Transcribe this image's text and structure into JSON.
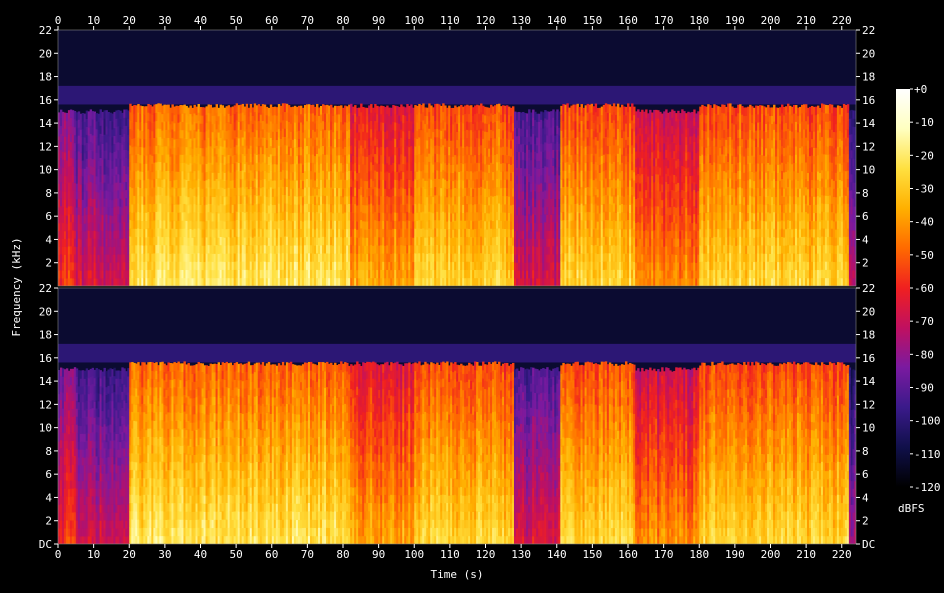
{
  "chart_data": {
    "type": "heatmap",
    "xlabel": "Time (s)",
    "ylabel": "Frequency (kHz)",
    "colorbar_label": "dBFS",
    "x_ticks": [
      0,
      10,
      20,
      30,
      40,
      50,
      60,
      70,
      80,
      90,
      100,
      110,
      120,
      130,
      140,
      150,
      160,
      170,
      180,
      190,
      200,
      210,
      220
    ],
    "xlim": [
      0,
      224
    ],
    "y_ticks": [
      "DC",
      "2",
      "4",
      "6",
      "8",
      "10",
      "12",
      "14",
      "16",
      "18",
      "20",
      "22"
    ],
    "y_tick_values": [
      0,
      2,
      4,
      6,
      8,
      10,
      12,
      14,
      16,
      18,
      20,
      22
    ],
    "ylim": [
      0,
      22
    ],
    "colorbar_ticks": [
      "+0",
      "-10",
      "-20",
      "-30",
      "-40",
      "-50",
      "-60",
      "-70",
      "-80",
      "-90",
      "-100",
      "-110",
      "-120"
    ],
    "colorbar_values": [
      0,
      -10,
      -20,
      -30,
      -40,
      -50,
      -60,
      -70,
      -80,
      -90,
      -100,
      -110,
      -120
    ],
    "colorbar_range": [
      -120,
      0
    ],
    "colormap": [
      "#000000",
      "#10104a",
      "#3a1a8a",
      "#7a1aa0",
      "#c01060",
      "#f02020",
      "#ff6a00",
      "#ffb000",
      "#ffe040",
      "#ffffc0",
      "#ffffff"
    ],
    "channels": 2,
    "segments": [
      {
        "t_start": 0,
        "t_end": 5,
        "level_dB": -75,
        "cutoff_kHz": 15
      },
      {
        "t_start": 5,
        "t_end": 20,
        "level_dB": -85,
        "cutoff_kHz": 15
      },
      {
        "t_start": 20,
        "t_end": 82,
        "level_dB": -40,
        "cutoff_kHz": 15.5
      },
      {
        "t_start": 82,
        "t_end": 100,
        "level_dB": -55,
        "cutoff_kHz": 15.5
      },
      {
        "t_start": 100,
        "t_end": 128,
        "level_dB": -45,
        "cutoff_kHz": 15.5
      },
      {
        "t_start": 128,
        "t_end": 141,
        "level_dB": -85,
        "cutoff_kHz": 15
      },
      {
        "t_start": 141,
        "t_end": 162,
        "level_dB": -45,
        "cutoff_kHz": 15.5
      },
      {
        "t_start": 162,
        "t_end": 180,
        "level_dB": -60,
        "cutoff_kHz": 15
      },
      {
        "t_start": 180,
        "t_end": 222,
        "level_dB": -45,
        "cutoff_kHz": 15.5
      },
      {
        "t_start": 222,
        "t_end": 224,
        "level_dB": -95,
        "cutoff_kHz": 15
      }
    ],
    "noise_floor_dB": -112
  }
}
